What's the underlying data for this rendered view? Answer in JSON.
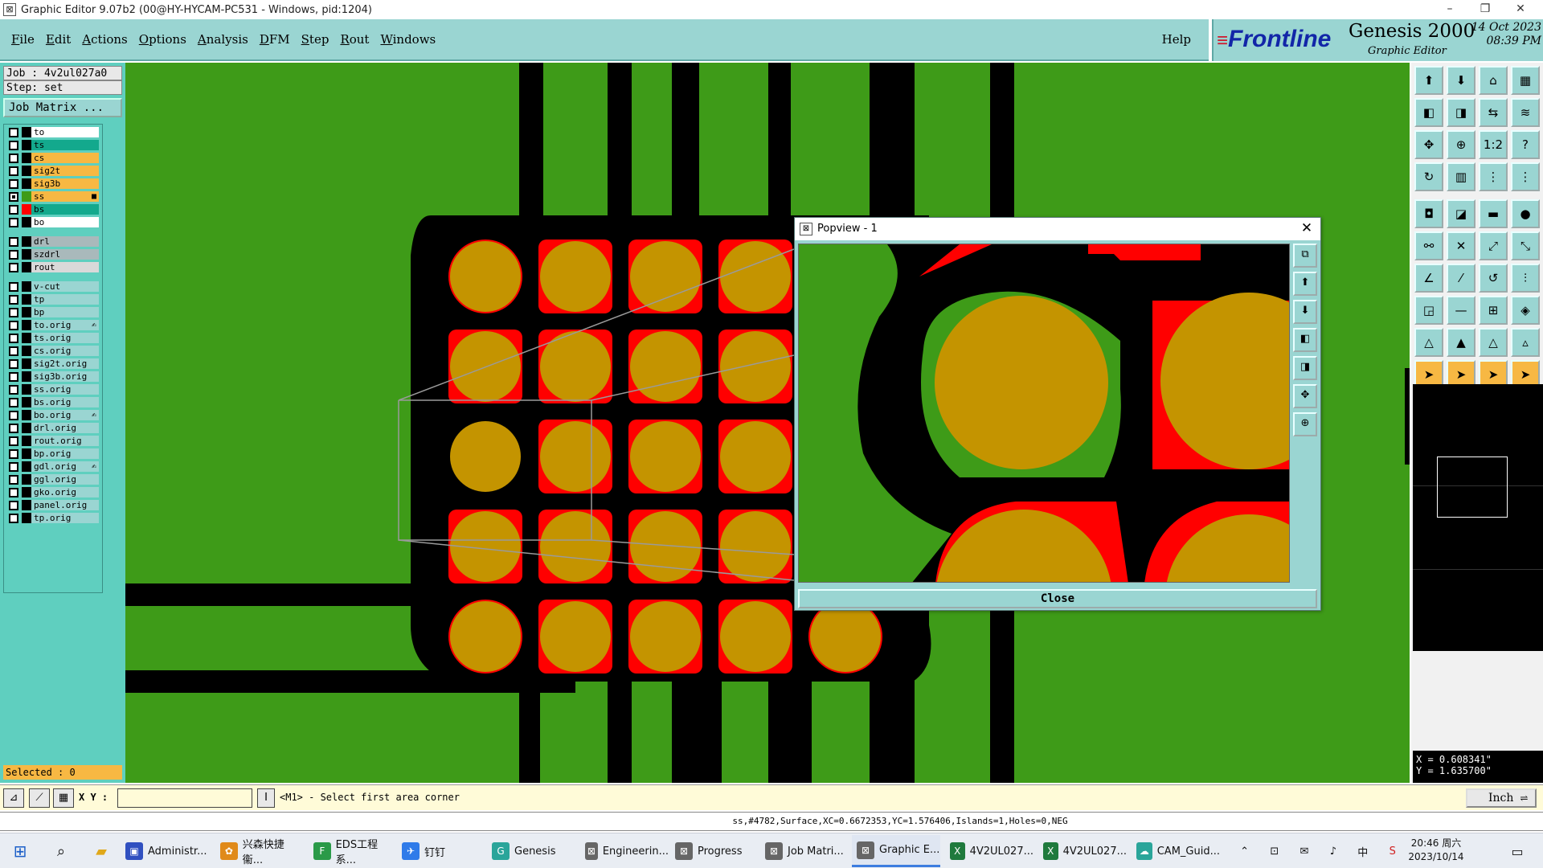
{
  "window": {
    "title": "Graphic Editor 9.07b2 (00@HY-HYCAM-PC531 - Windows, pid:1204)"
  },
  "menubar": {
    "items": [
      "File",
      "Edit",
      "Actions",
      "Options",
      "Analysis",
      "DFM",
      "Step",
      "Rout",
      "Windows"
    ],
    "help": "Help"
  },
  "brand": {
    "logo": "Frontline",
    "product": "Genesis 2000",
    "subtitle": "Graphic Editor",
    "date": "14 Oct 2023",
    "time": "08:39 PM"
  },
  "leftpanel": {
    "job": "Job : 4v2ul027a0",
    "step": "Step: set",
    "job_matrix_button": "Job Matrix ...",
    "selected": "Selected : 0"
  },
  "layers": [
    {
      "name": "to",
      "color": "#ffffff",
      "swatch": "#000000",
      "on": false,
      "mark": ""
    },
    {
      "name": "ts",
      "color": "#13a98d",
      "swatch": "#000000",
      "on": false,
      "mark": ""
    },
    {
      "name": "cs",
      "color": "#f7b843",
      "swatch": "#000000",
      "on": false,
      "mark": ""
    },
    {
      "name": "sig2t",
      "color": "#f7b843",
      "swatch": "#000000",
      "on": false,
      "mark": ""
    },
    {
      "name": "sig3b",
      "color": "#f7b843",
      "swatch": "#000000",
      "on": false,
      "mark": ""
    },
    {
      "name": "ss",
      "color": "#f7b843",
      "swatch": "#3e9b18",
      "on": true,
      "mark": "■"
    },
    {
      "name": "bs",
      "color": "#13a98d",
      "swatch": "#ff0000",
      "on": false,
      "mark": ""
    },
    {
      "name": "bo",
      "color": "#ffffff",
      "swatch": "#000000",
      "on": false,
      "mark": ""
    },
    {
      "name": "drl",
      "color": "#a9b9bb",
      "swatch": "#000000",
      "on": false,
      "mark": ""
    },
    {
      "name": "szdrl",
      "color": "#a9b9bb",
      "swatch": "#000000",
      "on": false,
      "mark": ""
    },
    {
      "name": "rout",
      "color": "#d9d9d9",
      "swatch": "#000000",
      "on": false,
      "mark": ""
    },
    {
      "name": "v-cut",
      "color": "#9ad5d2",
      "swatch": "#000000",
      "on": false,
      "mark": ""
    },
    {
      "name": "tp",
      "color": "#9ad5d2",
      "swatch": "#000000",
      "on": false,
      "mark": ""
    },
    {
      "name": "bp",
      "color": "#9ad5d2",
      "swatch": "#000000",
      "on": false,
      "mark": ""
    },
    {
      "name": "to.orig",
      "color": "#9ad5d2",
      "swatch": "#000000",
      "on": false,
      "mark": "✍"
    },
    {
      "name": "ts.orig",
      "color": "#9ad5d2",
      "swatch": "#000000",
      "on": false,
      "mark": ""
    },
    {
      "name": "cs.orig",
      "color": "#9ad5d2",
      "swatch": "#000000",
      "on": false,
      "mark": ""
    },
    {
      "name": "sig2t.orig",
      "color": "#9ad5d2",
      "swatch": "#000000",
      "on": false,
      "mark": ""
    },
    {
      "name": "sig3b.orig",
      "color": "#9ad5d2",
      "swatch": "#000000",
      "on": false,
      "mark": ""
    },
    {
      "name": "ss.orig",
      "color": "#9ad5d2",
      "swatch": "#000000",
      "on": false,
      "mark": ""
    },
    {
      "name": "bs.orig",
      "color": "#9ad5d2",
      "swatch": "#000000",
      "on": false,
      "mark": ""
    },
    {
      "name": "bo.orig",
      "color": "#9ad5d2",
      "swatch": "#000000",
      "on": false,
      "mark": "✍"
    },
    {
      "name": "drl.orig",
      "color": "#9ad5d2",
      "swatch": "#000000",
      "on": false,
      "mark": ""
    },
    {
      "name": "rout.orig",
      "color": "#9ad5d2",
      "swatch": "#000000",
      "on": false,
      "mark": ""
    },
    {
      "name": "bp.orig",
      "color": "#9ad5d2",
      "swatch": "#000000",
      "on": false,
      "mark": ""
    },
    {
      "name": "gdl.orig",
      "color": "#9ad5d2",
      "swatch": "#000000",
      "on": false,
      "mark": "✍"
    },
    {
      "name": "ggl.orig",
      "color": "#9ad5d2",
      "swatch": "#000000",
      "on": false,
      "mark": ""
    },
    {
      "name": "gko.orig",
      "color": "#9ad5d2",
      "swatch": "#000000",
      "on": false,
      "mark": ""
    },
    {
      "name": "panel.orig",
      "color": "#9ad5d2",
      "swatch": "#000000",
      "on": false,
      "mark": ""
    },
    {
      "name": "tp.orig",
      "color": "#9ad5d2",
      "swatch": "#000000",
      "on": false,
      "mark": ""
    }
  ],
  "colors": {
    "board": "#3e9b18",
    "trace": "#000000",
    "pad": "#c49400",
    "pad_ring": "#ff0000",
    "panel_teal": "#9ad5d2"
  },
  "toolbox": [
    {
      "icon": "open-job-icon",
      "glyph": "⬆",
      "hl": false
    },
    {
      "icon": "save-icon",
      "glyph": "⬇",
      "hl": false
    },
    {
      "icon": "home-icon",
      "glyph": "⌂",
      "hl": false
    },
    {
      "icon": "layout-icon",
      "glyph": "▦",
      "hl": false
    },
    {
      "icon": "pan-left-icon",
      "glyph": "◧",
      "hl": false
    },
    {
      "icon": "pan-right-icon",
      "glyph": "◨",
      "hl": false
    },
    {
      "icon": "mirror-icon",
      "glyph": "⇆",
      "hl": false
    },
    {
      "icon": "snap-icon",
      "glyph": "≋",
      "hl": false
    },
    {
      "icon": "zoom-fit-icon",
      "glyph": "✥",
      "hl": false
    },
    {
      "icon": "zoom-center-icon",
      "glyph": "⊕",
      "hl": false
    },
    {
      "icon": "scale-icon",
      "glyph": "1:2",
      "hl": false
    },
    {
      "icon": "help-icon",
      "glyph": "?",
      "hl": false
    },
    {
      "icon": "redraw-icon",
      "glyph": "↻",
      "hl": false
    },
    {
      "icon": "grid-icon",
      "glyph": "▥",
      "hl": false
    },
    {
      "icon": "measure-icon",
      "glyph": "⋮",
      "hl": false
    },
    {
      "icon": "measure-red-icon",
      "glyph": "⋮",
      "hl": false
    },
    {
      "icon": "camera-icon",
      "glyph": "◘",
      "hl": false
    },
    {
      "icon": "fill-icon",
      "glyph": "◪",
      "hl": false
    },
    {
      "icon": "ruler-icon",
      "glyph": "▬",
      "hl": false
    },
    {
      "icon": "pad-icon",
      "glyph": "●",
      "hl": false
    },
    {
      "icon": "connect-icon",
      "glyph": "⚯",
      "hl": false
    },
    {
      "icon": "cross-icon",
      "glyph": "✕",
      "hl": false
    },
    {
      "icon": "node-icon",
      "glyph": "⤢",
      "hl": false
    },
    {
      "icon": "link-icon",
      "glyph": "⤡",
      "hl": false
    },
    {
      "icon": "angle-icon",
      "glyph": "∠",
      "hl": false
    },
    {
      "icon": "line-icon",
      "glyph": "⁄",
      "hl": false
    },
    {
      "icon": "arc-icon",
      "glyph": "↺",
      "hl": false
    },
    {
      "icon": "split-icon",
      "glyph": "⫶",
      "hl": false
    },
    {
      "icon": "feature-icon",
      "glyph": "◲",
      "hl": false
    },
    {
      "icon": "minus-icon",
      "glyph": "—",
      "hl": false
    },
    {
      "icon": "align-icon",
      "glyph": "⊞",
      "hl": false
    },
    {
      "icon": "shapes-icon",
      "glyph": "◈",
      "hl": false
    },
    {
      "icon": "triangle-icon",
      "glyph": "△",
      "hl": false
    },
    {
      "icon": "triangle-red-icon",
      "glyph": "▲",
      "hl": false
    },
    {
      "icon": "triangle-blue-icon",
      "glyph": "△",
      "hl": false
    },
    {
      "icon": "triangle-alt-icon",
      "glyph": "▵",
      "hl": false
    },
    {
      "icon": "pointer-icon",
      "glyph": "➤",
      "hl": true
    },
    {
      "icon": "select-icon",
      "glyph": "➤",
      "hl": true
    },
    {
      "icon": "select-zoom-icon",
      "glyph": "➤",
      "hl": true
    },
    {
      "icon": "select-area-icon",
      "glyph": "➤",
      "hl": true
    }
  ],
  "coords": {
    "x": "X = 0.608341\"",
    "y": "Y = 1.635700\""
  },
  "cmdbar": {
    "xy_label": "X Y :",
    "xy_value": "",
    "prompt": "<M1> - Select first area corner",
    "units": "Inch"
  },
  "status": "ss,#4782,Surface,XC=0.6672353,YC=1.576406,Islands=1,Holes=0,NEG",
  "popview": {
    "title": "Popview - 1",
    "close_label": "Close"
  },
  "taskbar": {
    "items": [
      {
        "label": "Administr...",
        "color": "#3050c0",
        "glyph": "▣"
      },
      {
        "label": "兴森快捷衞...",
        "color": "#e08a1a",
        "glyph": "✿"
      },
      {
        "label": "EDS工程系...",
        "color": "#2a9a48",
        "glyph": "F"
      },
      {
        "label": "钉钉",
        "color": "#2f7be9",
        "glyph": "✈"
      },
      {
        "label": "Genesis",
        "color": "#2aa59a",
        "glyph": "G"
      },
      {
        "label": "Engineerin...",
        "color": "#666666",
        "glyph": "⊠"
      },
      {
        "label": "Progress",
        "color": "#666666",
        "glyph": "⊠"
      },
      {
        "label": "Job Matri...",
        "color": "#666666",
        "glyph": "⊠"
      },
      {
        "label": "Graphic E...",
        "color": "#666666",
        "glyph": "⊠"
      },
      {
        "label": "4V2UL027...",
        "color": "#1f7a3d",
        "glyph": "X"
      },
      {
        "label": "4V2UL027...",
        "color": "#1f7a3d",
        "glyph": "X"
      },
      {
        "label": "CAM_Guid...",
        "color": "#2aa59a",
        "glyph": "☁"
      }
    ],
    "ime": "中",
    "clock_time": "20:46 周六",
    "clock_date": "2023/10/14"
  }
}
